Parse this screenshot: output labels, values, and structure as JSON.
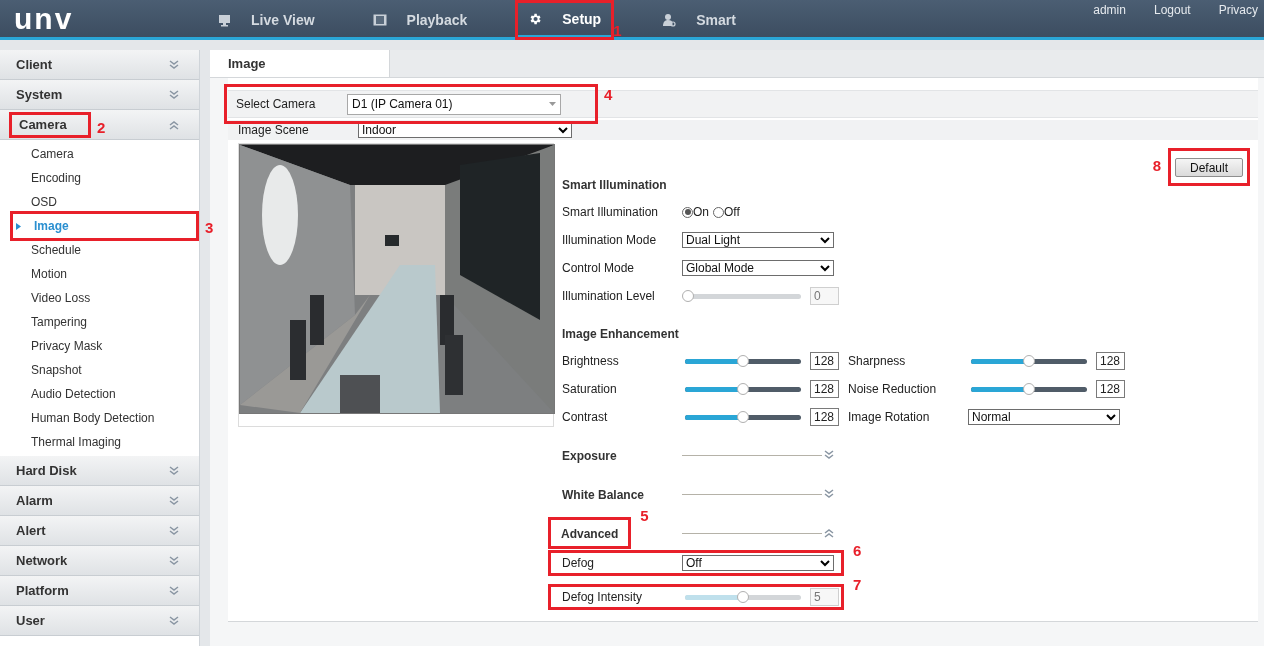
{
  "header": {
    "logo": "unv",
    "nav": [
      {
        "label": "Live View",
        "selected": false
      },
      {
        "label": "Playback",
        "selected": false
      },
      {
        "label": "Setup",
        "selected": true,
        "annotation": "1"
      },
      {
        "label": "Smart",
        "selected": false
      }
    ],
    "user_links": [
      "admin",
      "Logout",
      "Privacy"
    ]
  },
  "sidebar": [
    {
      "label": "Client",
      "expanded": false
    },
    {
      "label": "System",
      "expanded": false
    },
    {
      "label": "Camera",
      "expanded": true,
      "annotation": "2",
      "children": [
        {
          "label": "Camera",
          "selected": false
        },
        {
          "label": "Encoding",
          "selected": false
        },
        {
          "label": "OSD",
          "selected": false
        },
        {
          "label": "Image",
          "selected": true,
          "annotation": "3"
        },
        {
          "label": "Schedule",
          "selected": false
        },
        {
          "label": "Motion",
          "selected": false
        },
        {
          "label": "Video Loss",
          "selected": false
        },
        {
          "label": "Tampering",
          "selected": false
        },
        {
          "label": "Privacy Mask",
          "selected": false
        },
        {
          "label": "Snapshot",
          "selected": false
        },
        {
          "label": "Audio Detection",
          "selected": false
        },
        {
          "label": "Human Body Detection",
          "selected": false
        },
        {
          "label": "Thermal Imaging",
          "selected": false
        }
      ]
    },
    {
      "label": "Hard Disk",
      "expanded": false
    },
    {
      "label": "Alarm",
      "expanded": false
    },
    {
      "label": "Alert",
      "expanded": false
    },
    {
      "label": "Network",
      "expanded": false
    },
    {
      "label": "Platform",
      "expanded": false
    },
    {
      "label": "User",
      "expanded": false
    }
  ],
  "tabs": [
    {
      "label": "Image",
      "selected": true
    }
  ],
  "camera_select": {
    "label": "Select Camera",
    "value": "D1 (IP Camera 01)",
    "annotation": "4"
  },
  "image_scene": {
    "label": "Image Scene",
    "value": "Indoor"
  },
  "default_button": {
    "label": "Default",
    "annotation": "8"
  },
  "sections": [
    {
      "title": "Smart Illumination",
      "kind": "plain",
      "rows": [
        [
          {
            "kind": "radio",
            "label": "Smart Illumination",
            "options": [
              {
                "label": "On",
                "selected": true
              },
              {
                "label": "Off",
                "selected": false
              }
            ]
          }
        ],
        [
          {
            "kind": "select",
            "label": "Illumination Mode",
            "value": "Dual Light"
          }
        ],
        [
          {
            "kind": "select",
            "label": "Control Mode",
            "value": "Global Mode"
          }
        ],
        [
          {
            "kind": "slider",
            "label": "Illumination Level",
            "level": 0,
            "reading": "0",
            "disabled": true
          }
        ]
      ]
    },
    {
      "title": "Image Enhancement",
      "kind": "plain",
      "rows": [
        [
          {
            "kind": "slider",
            "label": "Brightness",
            "level": 0.5,
            "reading": "128",
            "disabled": false
          },
          {
            "kind": "slider",
            "label": "Sharpness",
            "level": 0.5,
            "reading": "128",
            "disabled": false
          }
        ],
        [
          {
            "kind": "slider",
            "label": "Saturation",
            "level": 0.5,
            "reading": "128",
            "disabled": false
          },
          {
            "kind": "slider",
            "label": "Noise Reduction",
            "level": 0.5,
            "reading": "128",
            "disabled": false
          }
        ],
        [
          {
            "kind": "slider",
            "label": "Contrast",
            "level": 0.5,
            "reading": "128",
            "disabled": false
          },
          {
            "kind": "select",
            "label": "Image Rotation",
            "value": "Normal"
          }
        ]
      ]
    },
    {
      "title": "Exposure",
      "kind": "collapsible",
      "expanded": false
    },
    {
      "title": "White Balance",
      "kind": "collapsible",
      "expanded": false
    },
    {
      "title": "Advanced",
      "kind": "collapsible",
      "expanded": true,
      "annotation": "5",
      "rows": [
        [
          {
            "kind": "select",
            "label": "Defog",
            "value": "Off",
            "annotation": "6"
          }
        ],
        [
          {
            "kind": "slider",
            "label": "Defog Intensity",
            "level": 0.5,
            "reading": "5",
            "disabled": true,
            "annotation": "7"
          }
        ]
      ]
    }
  ]
}
